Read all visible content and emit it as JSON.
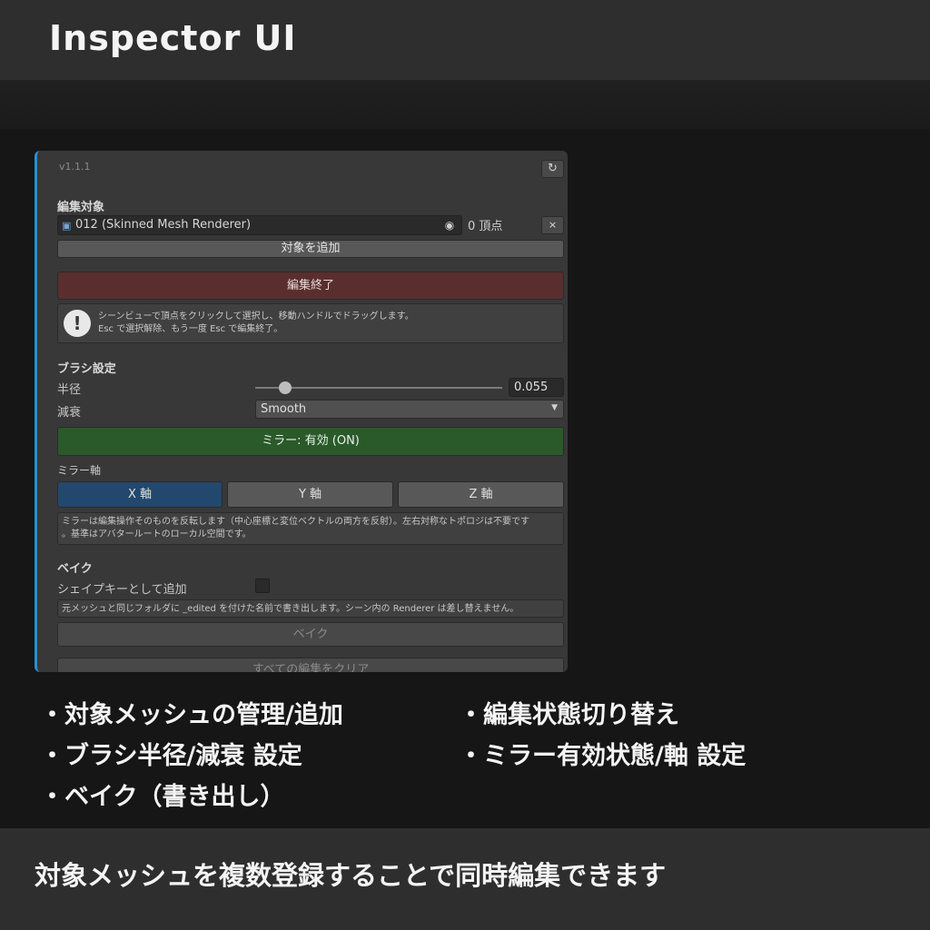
{
  "header": {
    "title": "Inspector UI"
  },
  "inspector": {
    "version": "v1.1.1",
    "refresh_icon": "refresh-icon",
    "target_section": {
      "title": "編集対象",
      "object_name": "012 (Skinned Mesh Renderer)",
      "object_icon": "mesh-icon",
      "pick_icon": "object-picker-icon",
      "vertex_count": "0 頂点",
      "remove_label": "×",
      "add_button": "対象を追加"
    },
    "edit_end_button": "編集終了",
    "help": {
      "icon": "exclamation-icon",
      "line1": "シーンビューで頂点をクリックして選択し、移動ハンドルでドラッグします。",
      "line2": "Esc で選択解除、もう一度 Esc で編集終了。"
    },
    "brush": {
      "title": "ブラシ設定",
      "radius_label": "半径",
      "radius_value": "0.055",
      "radius_slider_fraction": 0.1,
      "falloff_label": "減衰",
      "falloff_value": "Smooth"
    },
    "mirror": {
      "toggle_label": "ミラー: 有効 (ON)",
      "axis_title": "ミラー軸",
      "axes": [
        "X 軸",
        "Y 軸",
        "Z 軸"
      ],
      "selected_axis": "X 軸",
      "note_line1": "ミラーは編集操作そのものを反転します（中心座標と変位ベクトルの両方を反射）。左右対称なトポロジは不要です",
      "note_line2": "。基準はアバタールートのローカル空間です。"
    },
    "bake": {
      "title": "ベイク",
      "shapekey_label": "シェイプキーとして追加",
      "shapekey_checked": false,
      "note": "元メッシュと同じフォルダに _edited を付けた名前で書き出します。シーン内の Renderer は差し替えません。",
      "bake_button": "ベイク",
      "clear_button": "すべての編集をクリア"
    },
    "colors": {
      "accent_blue": "#2a8dd4",
      "end_red": "#5a2e2e",
      "mirror_green": "#2a5a2a",
      "axis_selected": "#22486e"
    }
  },
  "features": {
    "left": [
      "・対象メッシュの管理/追加",
      "・ブラシ半径/減衰 設定",
      "・ベイク（書き出し）"
    ],
    "right": [
      "・編集状態切り替え",
      "・ミラー有効状態/軸 設定"
    ]
  },
  "footer": {
    "text": "対象メッシュを複数登録することで同時編集できます"
  }
}
